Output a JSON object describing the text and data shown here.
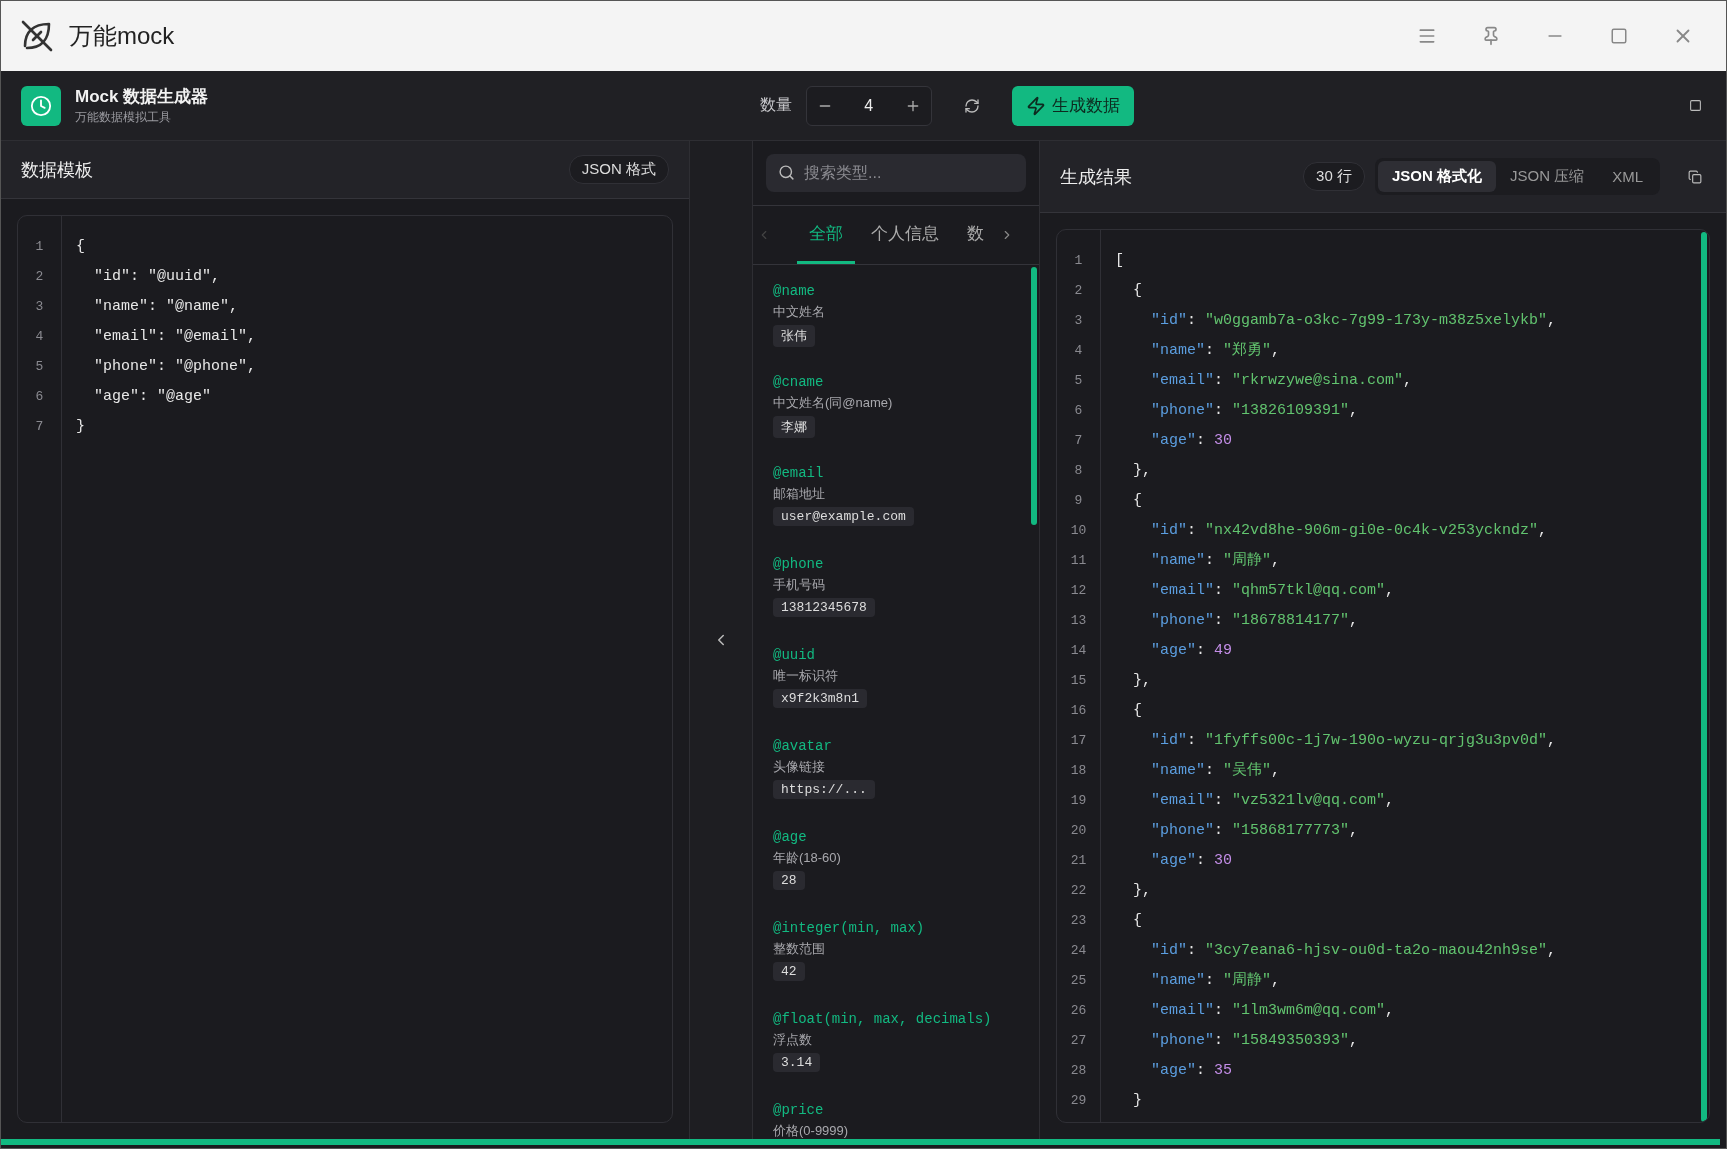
{
  "titlebar": {
    "title": "万能mock"
  },
  "toolbar": {
    "app_name": "Mock 数据生成器",
    "app_subtitle": "万能数据模拟工具",
    "quantity_label": "数量",
    "quantity": "4",
    "generate_button": "生成数据"
  },
  "template_panel": {
    "title": "数据模板",
    "format_badge": "JSON 格式",
    "lines": [
      {
        "no": "1",
        "text": "{"
      },
      {
        "no": "2",
        "text": "  \"id\": \"@uuid\","
      },
      {
        "no": "3",
        "text": "  \"name\": \"@name\","
      },
      {
        "no": "4",
        "text": "  \"email\": \"@email\","
      },
      {
        "no": "5",
        "text": "  \"phone\": \"@phone\","
      },
      {
        "no": "6",
        "text": "  \"age\": \"@age\""
      },
      {
        "no": "7",
        "text": "}"
      }
    ]
  },
  "types_panel": {
    "search": {
      "placeholder": "搜索类型..."
    },
    "tabs": [
      {
        "label": "全部",
        "selected": true
      },
      {
        "label": "个人信息",
        "selected": false
      },
      {
        "label": "数",
        "selected": false
      }
    ],
    "items": [
      {
        "name": "@name",
        "description": "中文姓名",
        "example": "张伟"
      },
      {
        "name": "@cname",
        "description": "中文姓名(同@name)",
        "example": "李娜"
      },
      {
        "name": "@email",
        "description": "邮箱地址",
        "example": "user@example.com"
      },
      {
        "name": "@phone",
        "description": "手机号码",
        "example": "13812345678"
      },
      {
        "name": "@uuid",
        "description": "唯一标识符",
        "example": "x9f2k3m8n1"
      },
      {
        "name": "@avatar",
        "description": "头像链接",
        "example": "https://..."
      },
      {
        "name": "@age",
        "description": "年龄(18-60)",
        "example": "28"
      },
      {
        "name": "@integer(min, max)",
        "description": "整数范围",
        "example": "42"
      },
      {
        "name": "@float(min, max, decimals)",
        "description": "浮点数",
        "example": "3.14"
      },
      {
        "name": "@price",
        "description": "价格(0-9999)"
      }
    ]
  },
  "result_panel": {
    "title": "生成结果",
    "line_count": "30 行",
    "formats": [
      {
        "label": "JSON 格式化",
        "selected": true
      },
      {
        "label": "JSON 压缩",
        "selected": false
      },
      {
        "label": "XML",
        "selected": false
      }
    ],
    "lines": [
      {
        "no": "1",
        "tokens": [
          {
            "kind": "punct",
            "text": "["
          }
        ]
      },
      {
        "no": "2",
        "tokens": [
          {
            "kind": "punct",
            "text": "  {"
          }
        ]
      },
      {
        "no": "3",
        "tokens": [
          {
            "kind": "key",
            "text": "    \"id\""
          },
          {
            "kind": "punct",
            "text": ": "
          },
          {
            "kind": "string",
            "text": "\"w0ggamb7a-o3kc-7g99-173y-m38z5xelykb\""
          },
          {
            "kind": "punct",
            "text": ","
          }
        ]
      },
      {
        "no": "4",
        "tokens": [
          {
            "kind": "key",
            "text": "    \"name\""
          },
          {
            "kind": "punct",
            "text": ": "
          },
          {
            "kind": "string",
            "text": "\"郑勇\""
          },
          {
            "kind": "punct",
            "text": ","
          }
        ]
      },
      {
        "no": "5",
        "tokens": [
          {
            "kind": "key",
            "text": "    \"email\""
          },
          {
            "kind": "punct",
            "text": ": "
          },
          {
            "kind": "string",
            "text": "\"rkrwzywe@sina.com\""
          },
          {
            "kind": "punct",
            "text": ","
          }
        ]
      },
      {
        "no": "6",
        "tokens": [
          {
            "kind": "key",
            "text": "    \"phone\""
          },
          {
            "kind": "punct",
            "text": ": "
          },
          {
            "kind": "string",
            "text": "\"13826109391\""
          },
          {
            "kind": "punct",
            "text": ","
          }
        ]
      },
      {
        "no": "7",
        "tokens": [
          {
            "kind": "key",
            "text": "    \"age\""
          },
          {
            "kind": "punct",
            "text": ": "
          },
          {
            "kind": "number",
            "text": "30"
          }
        ]
      },
      {
        "no": "8",
        "tokens": [
          {
            "kind": "punct",
            "text": "  },"
          }
        ]
      },
      {
        "no": "9",
        "tokens": [
          {
            "kind": "punct",
            "text": "  {"
          }
        ]
      },
      {
        "no": "10",
        "tokens": [
          {
            "kind": "key",
            "text": "    \"id\""
          },
          {
            "kind": "punct",
            "text": ": "
          },
          {
            "kind": "string",
            "text": "\"nx42vd8he-906m-gi0e-0c4k-v253yckndz\""
          },
          {
            "kind": "punct",
            "text": ","
          }
        ]
      },
      {
        "no": "11",
        "tokens": [
          {
            "kind": "key",
            "text": "    \"name\""
          },
          {
            "kind": "punct",
            "text": ": "
          },
          {
            "kind": "string",
            "text": "\"周静\""
          },
          {
            "kind": "punct",
            "text": ","
          }
        ]
      },
      {
        "no": "12",
        "tokens": [
          {
            "kind": "key",
            "text": "    \"email\""
          },
          {
            "kind": "punct",
            "text": ": "
          },
          {
            "kind": "string",
            "text": "\"qhm57tkl@qq.com\""
          },
          {
            "kind": "punct",
            "text": ","
          }
        ]
      },
      {
        "no": "13",
        "tokens": [
          {
            "kind": "key",
            "text": "    \"phone\""
          },
          {
            "kind": "punct",
            "text": ": "
          },
          {
            "kind": "string",
            "text": "\"18678814177\""
          },
          {
            "kind": "punct",
            "text": ","
          }
        ]
      },
      {
        "no": "14",
        "tokens": [
          {
            "kind": "key",
            "text": "    \"age\""
          },
          {
            "kind": "punct",
            "text": ": "
          },
          {
            "kind": "number",
            "text": "49"
          }
        ]
      },
      {
        "no": "15",
        "tokens": [
          {
            "kind": "punct",
            "text": "  },"
          }
        ]
      },
      {
        "no": "16",
        "tokens": [
          {
            "kind": "punct",
            "text": "  {"
          }
        ]
      },
      {
        "no": "17",
        "tokens": [
          {
            "kind": "key",
            "text": "    \"id\""
          },
          {
            "kind": "punct",
            "text": ": "
          },
          {
            "kind": "string",
            "text": "\"1fyffs00c-1j7w-190o-wyzu-qrjg3u3pv0d\""
          },
          {
            "kind": "punct",
            "text": ","
          }
        ]
      },
      {
        "no": "18",
        "tokens": [
          {
            "kind": "key",
            "text": "    \"name\""
          },
          {
            "kind": "punct",
            "text": ": "
          },
          {
            "kind": "string",
            "text": "\"吴伟\""
          },
          {
            "kind": "punct",
            "text": ","
          }
        ]
      },
      {
        "no": "19",
        "tokens": [
          {
            "kind": "key",
            "text": "    \"email\""
          },
          {
            "kind": "punct",
            "text": ": "
          },
          {
            "kind": "string",
            "text": "\"vz5321lv@qq.com\""
          },
          {
            "kind": "punct",
            "text": ","
          }
        ]
      },
      {
        "no": "20",
        "tokens": [
          {
            "kind": "key",
            "text": "    \"phone\""
          },
          {
            "kind": "punct",
            "text": ": "
          },
          {
            "kind": "string",
            "text": "\"15868177773\""
          },
          {
            "kind": "punct",
            "text": ","
          }
        ]
      },
      {
        "no": "21",
        "tokens": [
          {
            "kind": "key",
            "text": "    \"age\""
          },
          {
            "kind": "punct",
            "text": ": "
          },
          {
            "kind": "number",
            "text": "30"
          }
        ]
      },
      {
        "no": "22",
        "tokens": [
          {
            "kind": "punct",
            "text": "  },"
          }
        ]
      },
      {
        "no": "23",
        "tokens": [
          {
            "kind": "punct",
            "text": "  {"
          }
        ]
      },
      {
        "no": "24",
        "tokens": [
          {
            "kind": "key",
            "text": "    \"id\""
          },
          {
            "kind": "punct",
            "text": ": "
          },
          {
            "kind": "string",
            "text": "\"3cy7eana6-hjsv-ou0d-ta2o-maou42nh9se\""
          },
          {
            "kind": "punct",
            "text": ","
          }
        ]
      },
      {
        "no": "25",
        "tokens": [
          {
            "kind": "key",
            "text": "    \"name\""
          },
          {
            "kind": "punct",
            "text": ": "
          },
          {
            "kind": "string",
            "text": "\"周静\""
          },
          {
            "kind": "punct",
            "text": ","
          }
        ]
      },
      {
        "no": "26",
        "tokens": [
          {
            "kind": "key",
            "text": "    \"email\""
          },
          {
            "kind": "punct",
            "text": ": "
          },
          {
            "kind": "string",
            "text": "\"1lm3wm6m@qq.com\""
          },
          {
            "kind": "punct",
            "text": ","
          }
        ]
      },
      {
        "no": "27",
        "tokens": [
          {
            "kind": "key",
            "text": "    \"phone\""
          },
          {
            "kind": "punct",
            "text": ": "
          },
          {
            "kind": "string",
            "text": "\"15849350393\""
          },
          {
            "kind": "punct",
            "text": ","
          }
        ]
      },
      {
        "no": "28",
        "tokens": [
          {
            "kind": "key",
            "text": "    \"age\""
          },
          {
            "kind": "punct",
            "text": ": "
          },
          {
            "kind": "number",
            "text": "35"
          }
        ]
      },
      {
        "no": "29",
        "tokens": [
          {
            "kind": "punct",
            "text": "  }"
          }
        ]
      }
    ]
  }
}
